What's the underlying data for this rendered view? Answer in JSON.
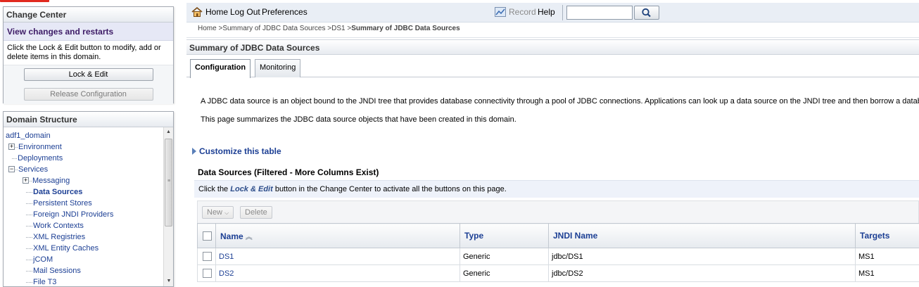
{
  "change_center": {
    "title": "Change Center",
    "subtitle": "View changes and restarts",
    "description": "Click the Lock & Edit button to modify, add or delete items in this domain.",
    "lock_edit_label": "Lock & Edit",
    "release_label": "Release Configuration"
  },
  "domain_structure": {
    "title": "Domain Structure",
    "items": [
      {
        "label": "adf1_domain",
        "icon": "none"
      },
      {
        "label": "Environment",
        "icon": "expand"
      },
      {
        "label": "Deployments",
        "icon": "line"
      },
      {
        "label": "Services",
        "icon": "collapse"
      },
      {
        "label": "Messaging",
        "icon": "expand"
      },
      {
        "label": "Data Sources",
        "icon": "line"
      },
      {
        "label": "Persistent Stores",
        "icon": "line"
      },
      {
        "label": "Foreign JNDI Providers",
        "icon": "line"
      },
      {
        "label": "Work Contexts",
        "icon": "line"
      },
      {
        "label": "XML Registries",
        "icon": "line"
      },
      {
        "label": "XML Entity Caches",
        "icon": "line"
      },
      {
        "label": "jCOM",
        "icon": "line"
      },
      {
        "label": "Mail Sessions",
        "icon": "line"
      },
      {
        "label": "File T3",
        "icon": "line"
      }
    ]
  },
  "toolbar": {
    "home": "Home",
    "logout": "Log Out",
    "preferences": "Preferences",
    "record": "Record",
    "help": "Help",
    "search_value": ""
  },
  "breadcrumb": {
    "home": "Home",
    "summary_jdbc": "Summary of JDBC Data Sources",
    "ds1": "DS1",
    "current": "Summary of JDBC Data Sources"
  },
  "page": {
    "title": "Summary of JDBC Data Sources",
    "tabs": [
      "Configuration",
      "Monitoring"
    ],
    "description_1": "A JDBC data source is an object bound to the JNDI tree that provides database connectivity through a pool of JDBC connections. Applications can look up a data source on the JNDI tree and then borrow a database",
    "description_2": "This page summarizes the JDBC data source objects that have been created in this domain.",
    "customize": "Customize this table"
  },
  "data_sources": {
    "title": "Data Sources (Filtered - More Columns Exist)",
    "notice_pre": "Click the ",
    "notice_em": "Lock & Edit",
    "notice_post": " button in the Change Center to activate all the buttons on this page.",
    "new_label": "New",
    "delete_label": "Delete",
    "columns": [
      "Name",
      "Type",
      "JNDI Name",
      "Targets"
    ],
    "rows": [
      {
        "name": "DS1",
        "type": "Generic",
        "jndi": "jdbc/DS1",
        "targets": "MS1"
      },
      {
        "name": "DS2",
        "type": "Generic",
        "jndi": "jdbc/DS2",
        "targets": "MS1"
      }
    ]
  },
  "colors": {
    "link": "#1c3f94",
    "toolbar_bg": "#e9eef5",
    "notice_bg": "#eef2fa",
    "brand": "#e12a1f"
  }
}
